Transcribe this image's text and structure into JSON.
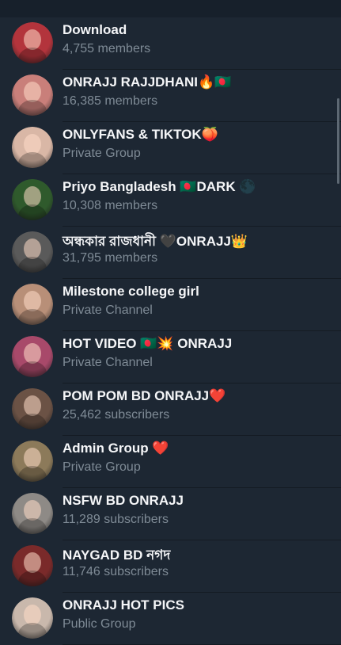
{
  "chats": [
    {
      "title": "Download",
      "subtitle": "4,755 members",
      "color": "#b3343c"
    },
    {
      "title": "ONRAJJ RAJJDHANI🔥🇧🇩",
      "subtitle": "16,385 members",
      "color": "#c97f7a"
    },
    {
      "title": "ONLYFANS & TIKTOK🍑",
      "subtitle": "Private Group",
      "color": "#d9b7a6"
    },
    {
      "title": "Priyo Bangladesh 🇧🇩DARK 🌑",
      "subtitle": "10,308 members",
      "color": "#2f5a2c"
    },
    {
      "title": "অন্ধকার রাজধানী 🖤ONRAJJ👑",
      "subtitle": "31,795 members",
      "color": "#5a5a5a"
    },
    {
      "title": "Milestone college girl",
      "subtitle": "Private Channel",
      "color": "#b88f78"
    },
    {
      "title": "HOT VIDEO 🇧🇩💥 ONRAJJ",
      "subtitle": "Private Channel",
      "color": "#a8496a"
    },
    {
      "title": "POM POM BD ONRAJJ❤️",
      "subtitle": "25,462 subscribers",
      "color": "#6b5245"
    },
    {
      "title": "Admin Group ❤️",
      "subtitle": "Private Group",
      "color": "#8c7a5a"
    },
    {
      "title": "NSFW BD ONRAJJ",
      "subtitle": "11,289 subscribers",
      "color": "#8e8a86"
    },
    {
      "title": "NAYGAD BD নগদ",
      "subtitle": "11,746 subscribers",
      "color": "#7a2a2a"
    },
    {
      "title": "ONRAJJ HOT PICS",
      "subtitle": "Public Group",
      "color": "#c9b8ac"
    }
  ]
}
